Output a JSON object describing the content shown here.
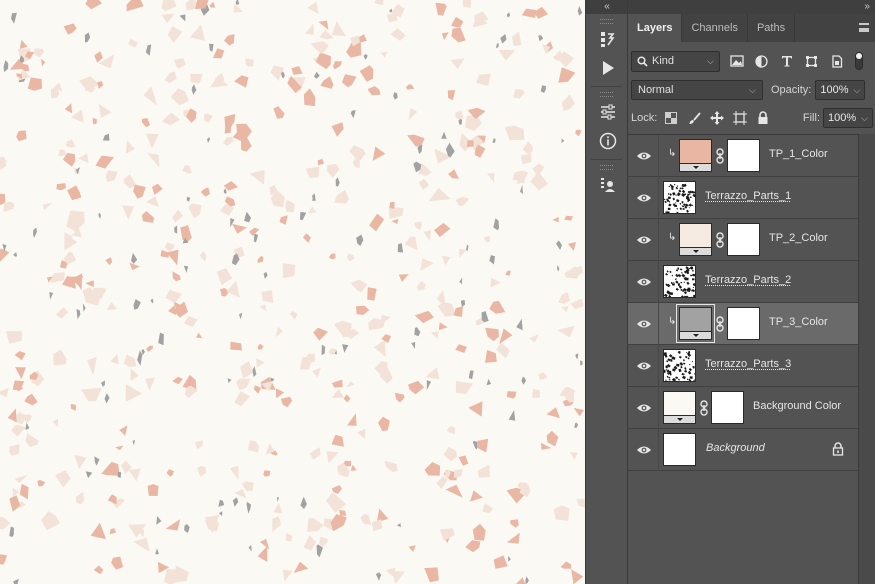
{
  "canvas": {
    "background": "#fbf9f4",
    "chip_colors": {
      "peach": "#e9b7a3",
      "gray": "#a3a2a2",
      "cream": "#f3e2d7"
    }
  },
  "collapse_left": "‹‹",
  "collapse_right": "››",
  "tabs": [
    {
      "label": "Layers",
      "active": true
    },
    {
      "label": "Channels",
      "active": false
    },
    {
      "label": "Paths",
      "active": false
    }
  ],
  "filter": {
    "kind_label": "Kind"
  },
  "blend": {
    "mode": "Normal",
    "opacity_label": "Opacity:",
    "opacity_value": "100%"
  },
  "lock": {
    "label": "Lock:",
    "fill_label": "Fill:",
    "fill_value": "100%"
  },
  "layers": [
    {
      "name": "TP_1_Color",
      "kind": "fill",
      "swatch": "#e8b6a2",
      "clipped": true,
      "selected": false,
      "italic": false,
      "underline": false
    },
    {
      "name": "Terrazzo_Parts_1",
      "kind": "pattern",
      "clipped": false,
      "selected": false,
      "italic": false,
      "underline": true
    },
    {
      "name": "TP_2_Color",
      "kind": "fill",
      "swatch": "#f6ebe2",
      "clipped": true,
      "selected": false,
      "italic": false,
      "underline": false
    },
    {
      "name": "Terrazzo_Parts_2",
      "kind": "pattern",
      "clipped": false,
      "selected": false,
      "italic": false,
      "underline": true
    },
    {
      "name": "TP_3_Color",
      "kind": "fill",
      "swatch": "#a3a2a2",
      "clipped": true,
      "selected": true,
      "italic": false,
      "underline": false
    },
    {
      "name": "Terrazzo_Parts_3",
      "kind": "pattern",
      "clipped": false,
      "selected": false,
      "italic": false,
      "underline": true
    },
    {
      "name": "Background Color",
      "kind": "fill",
      "swatch": "#fbf9f4",
      "clipped": false,
      "selected": false,
      "italic": false,
      "underline": false
    },
    {
      "name": "Background",
      "kind": "plain",
      "clipped": false,
      "selected": false,
      "italic": true,
      "underline": false,
      "locked": true
    }
  ]
}
